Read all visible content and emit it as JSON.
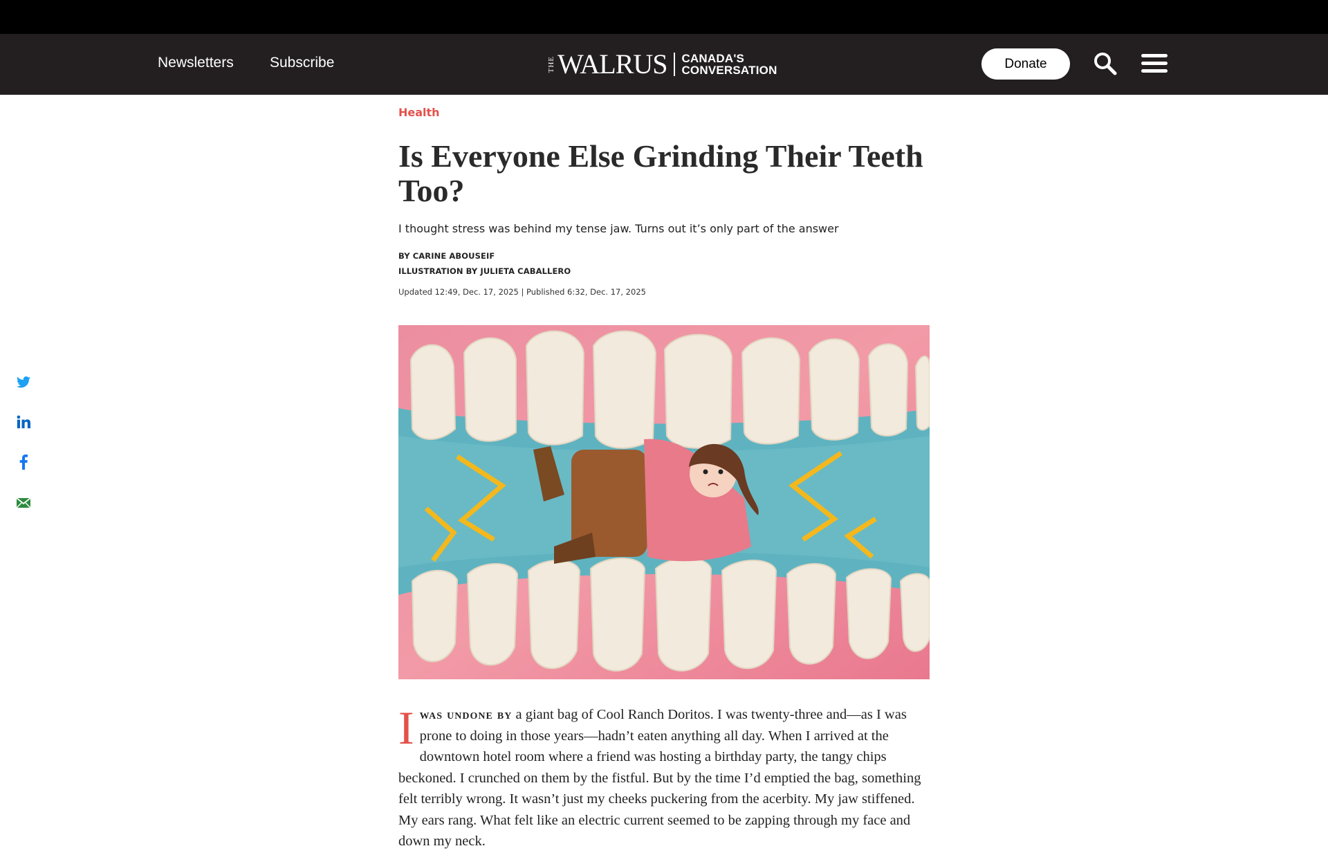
{
  "nav": {
    "newsletters": "Newsletters",
    "subscribe": "Subscribe",
    "logo_the": "THE",
    "logo_name": "WALRUS",
    "logo_tag_line1": "CANADA'S",
    "logo_tag_line2": "CONVERSATION",
    "donate": "Donate",
    "icons": [
      "search-icon",
      "hamburger-menu-icon"
    ]
  },
  "share": {
    "icons": [
      "twitter-icon",
      "linkedin-icon",
      "facebook-icon",
      "email-icon"
    ],
    "colors": {
      "twitter": "#1da1f2",
      "linkedin": "#0a66c2",
      "facebook": "#1877f2",
      "email": "#2e8b3d"
    }
  },
  "article": {
    "category": "Health",
    "headline": "Is Everyone Else Grinding Their Teeth Too?",
    "dek": "I thought stress was behind my tense jaw. Turns out it’s only part of the answer",
    "byline": "BY CARINE ABOUSEIF",
    "illustration_credit": "ILLUSTRATION BY JULIETA CABALLERO",
    "dates": "Updated 12:49, Dec. 17, 2025 | Published 6:32, Dec. 17, 2025",
    "body": {
      "dropcap": "I",
      "lead_in": "was undone by",
      "text": " a giant bag of Cool Ranch Doritos. I was twenty-three and—as I was prone to doing in those years—hadn’t eaten anything all day. When I arrived at the downtown hotel room where a friend was hosting a birthday party, the tangy chips beckoned. I crunched on them by the fistful. But by the time I’d emptied the bag, something felt terribly wrong. It wasn’t just my cheeks puckering from the acerbity. My jaw stiffened. My ears rang. What felt like an electric current seemed to be zapping through my face and down my neck."
    }
  },
  "colors": {
    "accent": "#e4514b",
    "nav_bg": "#231f20",
    "top_bar": "#000000"
  }
}
